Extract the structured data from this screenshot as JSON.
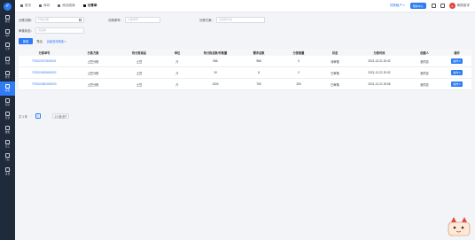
{
  "sidebar": {
    "items": [
      {
        "label": "概况",
        "icon": "dashboard-icon"
      },
      {
        "label": "用户",
        "icon": "user-icon"
      },
      {
        "label": "订单",
        "icon": "order-icon"
      },
      {
        "label": "商品",
        "icon": "product-icon"
      },
      {
        "label": "财务",
        "icon": "finance-icon"
      },
      {
        "label": "库存",
        "icon": "inventory-icon"
      },
      {
        "label": "配送",
        "icon": "delivery-icon"
      },
      {
        "label": "营销",
        "icon": "marketing-icon"
      },
      {
        "label": "数据",
        "icon": "data-icon"
      },
      {
        "label": "员工",
        "icon": "staff-icon"
      },
      {
        "label": "门店",
        "icon": "store-icon"
      },
      {
        "label": "设置",
        "icon": "settings-icon"
      }
    ],
    "active_index": 5
  },
  "topbar": {
    "tabs": [
      "首页",
      "库存",
      "商品档案",
      "分拣单"
    ],
    "active_tab": 3,
    "tenant": "切换租户",
    "pill": "帮助中心",
    "username": "你的名字"
  },
  "filters": {
    "date_label": "分拣日期：",
    "date_placeholder": "开始日期",
    "sort_no_label": "分拣单号：",
    "sort_no_placeholder": "分拣单号",
    "plan_label": "分拣方案：",
    "plan_placeholder": "请选择方案",
    "status_label": "审核状态：",
    "status_placeholder": "请选择"
  },
  "actions": {
    "add": "新增",
    "export": "导出",
    "more": "高级查询筛选"
  },
  "table": {
    "columns": [
      "分拣单号",
      "分拣方案",
      "待分拣商品",
      "单位",
      "待分拣总数/件数量",
      "需求总数",
      "分拣数量",
      "状态",
      "分拣时间",
      "创建人",
      "操作"
    ],
    "rows": [
      {
        "no": "FS2024070600001",
        "plan": "土豆分拣",
        "product": "土豆",
        "unit": "斤",
        "pending": "986",
        "demand": "986",
        "sorted": "0",
        "status": "待审核",
        "time": "2021-12-21 20:32",
        "creator": "张同志",
        "op": "操作"
      },
      {
        "no": "FS2024050600002",
        "plan": "土豆分拣",
        "product": "土豆",
        "unit": "斤",
        "pending": "10",
        "demand": "8",
        "sorted": "2",
        "status": "已审核",
        "time": "2021-12-21 20:32",
        "creator": "张同志",
        "op": "操作"
      },
      {
        "no": "FS2024081000003",
        "plan": "土豆分拣",
        "product": "土豆",
        "unit": "斤",
        "pending": "1000",
        "demand": "750",
        "sorted": "250",
        "status": "已审核",
        "time": "2021-12-21 20:56",
        "creator": "张同志",
        "op": "操作"
      }
    ]
  },
  "pagination": {
    "total": "共 3 条",
    "current": "1",
    "page_size": "10 条/页"
  },
  "colors": {
    "primary": "#2d7cf6",
    "sidebar": "#1f2b3b"
  }
}
